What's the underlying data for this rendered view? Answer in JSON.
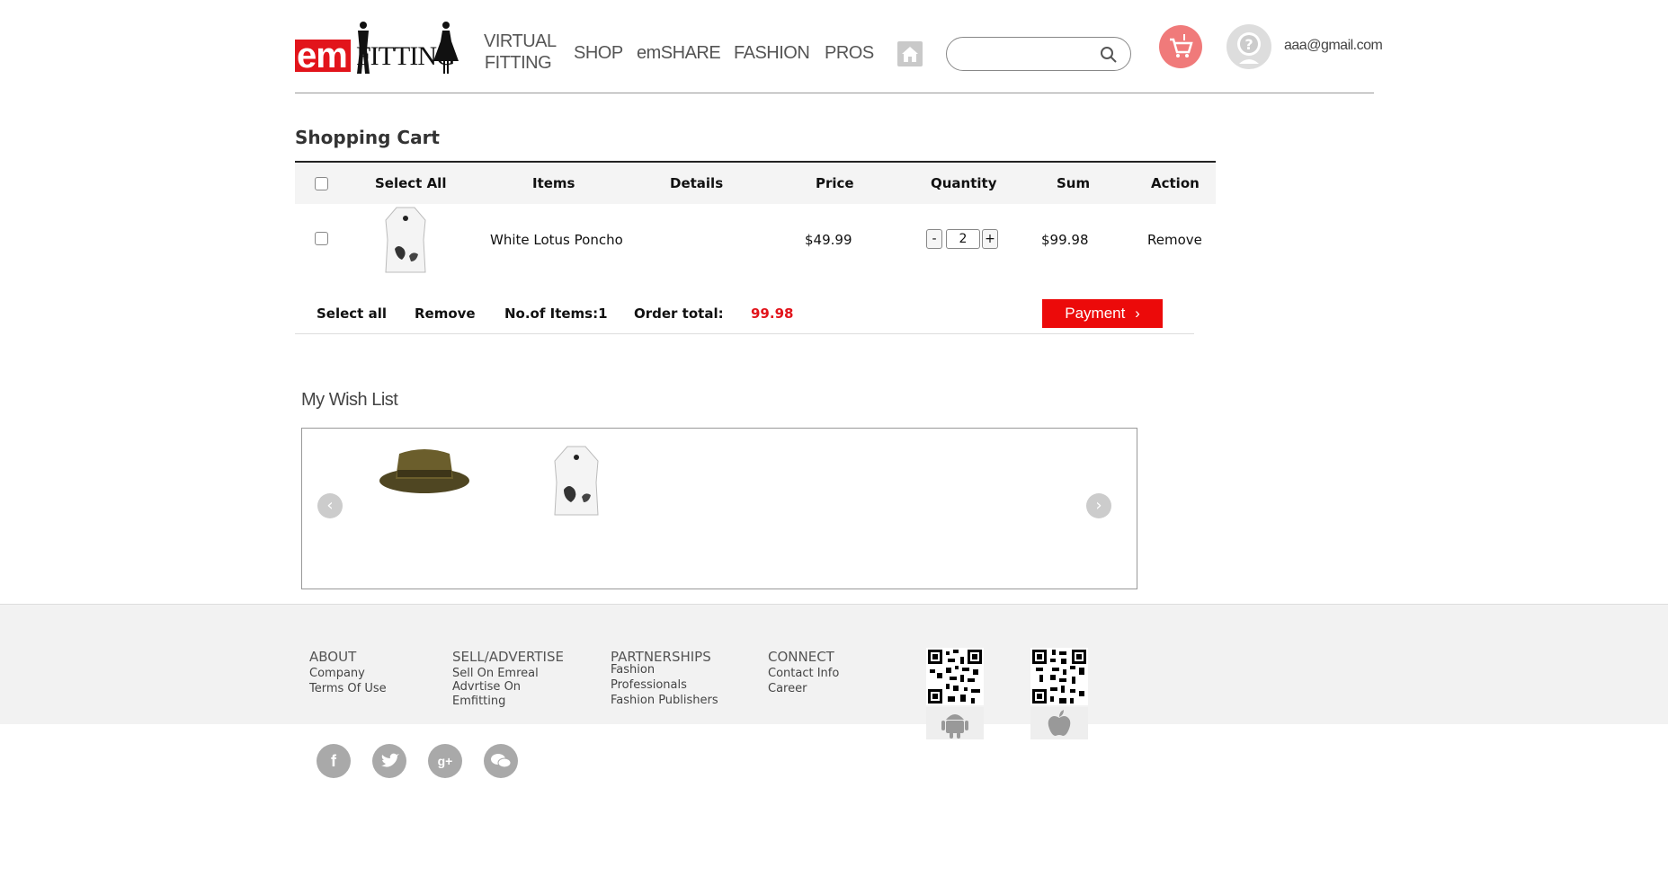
{
  "header": {
    "logo_em": "em",
    "logo_fitting": "FITTING",
    "nav": {
      "virtual_line1": "VIRTUAL",
      "virtual_line2": "FITTING",
      "shop": "SHOP",
      "emshare": "emSHARE",
      "fashion": "FASHION",
      "pros": "PROS"
    },
    "search_placeholder": "",
    "email": "aaa@gmail.com",
    "cart_color": "#f07a7a"
  },
  "cart": {
    "title": "Shopping Cart",
    "columns": {
      "select_all": "Select All",
      "items": "Items",
      "details": "Details",
      "price": "Price",
      "quantity": "Quantity",
      "sum": "Sum",
      "action": "Action"
    },
    "rows": [
      {
        "name": "White Lotus Poncho",
        "price": "$49.99",
        "quantity": "2",
        "minus": "-",
        "plus": "+",
        "sum": "$99.98",
        "action": "Remove"
      }
    ],
    "footer": {
      "select_all": "Select all",
      "remove": "Remove",
      "num_items": "No.of Items:1",
      "order_total_label": "Order total:",
      "order_total_value": "99.98",
      "payment": "Payment"
    }
  },
  "wishlist": {
    "title": "My Wish List",
    "items": [
      "hat",
      "poncho"
    ]
  },
  "footer": {
    "about": {
      "title": "ABOUT",
      "links": [
        "Company",
        "Terms Of Use"
      ]
    },
    "sell": {
      "title": "SELL/ADVERTISE",
      "links": [
        "Sell On Emreal",
        "Advrtise On",
        "Emfitting"
      ]
    },
    "partnerships": {
      "title": "PARTNERSHIPS",
      "links": [
        "Fashion",
        "Professionals",
        "Fashion Publishers"
      ]
    },
    "connect": {
      "title": "CONNECT",
      "links": [
        "Contact Info",
        "Career"
      ]
    },
    "apps": [
      "android-icon",
      "apple-icon"
    ],
    "social": [
      "facebook-icon",
      "twitter-icon",
      "googleplus-icon",
      "wechat-icon"
    ]
  },
  "colors": {
    "accent": "#ec0a0a",
    "total": "#e2141b"
  }
}
